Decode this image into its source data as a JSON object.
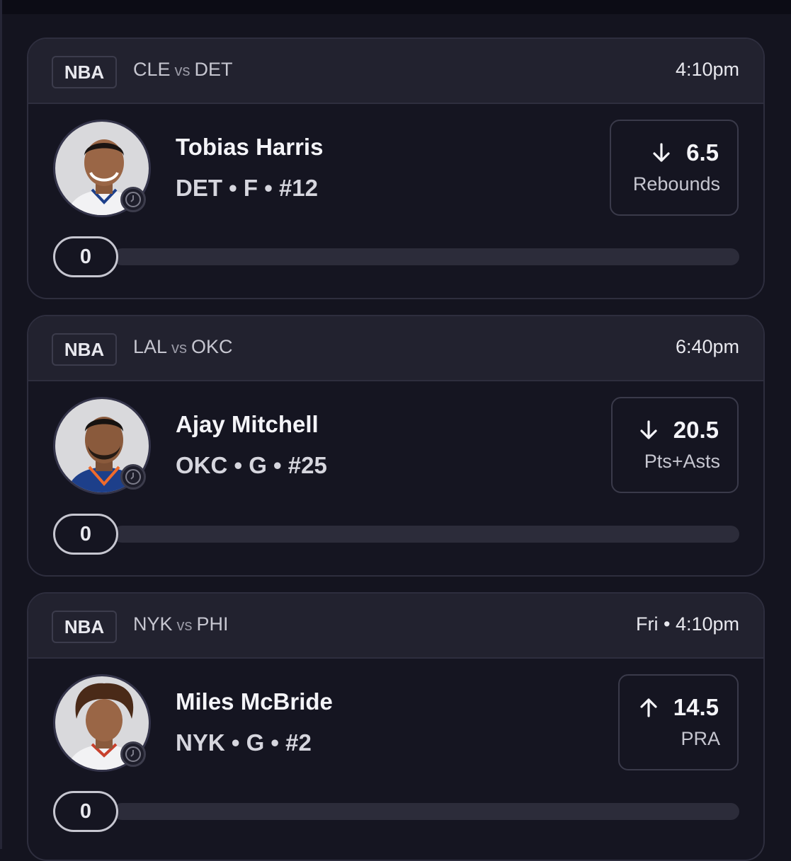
{
  "cards": [
    {
      "league": "NBA",
      "home": "CLE",
      "vs": "vs",
      "away": "DET",
      "time": "4:10pm",
      "player": "Tobias Harris",
      "info": "DET • F • #12",
      "direction": "down",
      "line": "6.5",
      "stat": "Rebounds",
      "progress": "0",
      "jersey_color": "#f2f2f4"
    },
    {
      "league": "NBA",
      "home": "LAL",
      "vs": "vs",
      "away": "OKC",
      "time": "6:40pm",
      "player": "Ajay Mitchell",
      "info": "OKC • G • #25",
      "direction": "down",
      "line": "20.5",
      "stat": "Pts+Asts",
      "progress": "0",
      "jersey_color": "#1d3f8a"
    },
    {
      "league": "NBA",
      "home": "NYK",
      "vs": "vs",
      "away": "PHI",
      "time": "Fri • 4:10pm",
      "player": "Miles McBride",
      "info": "NYK • G • #2",
      "direction": "up",
      "line": "14.5",
      "stat": "PRA",
      "progress": "0",
      "jersey_color": "#f2f2f4"
    }
  ]
}
